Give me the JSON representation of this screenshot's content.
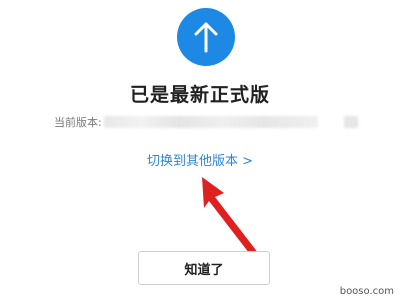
{
  "header": {
    "status_icon": "upload-arrow-icon",
    "title": "已是最新正式版"
  },
  "version": {
    "label": "当前版本:"
  },
  "link": {
    "switch_label": "切换到其他版本 >"
  },
  "footer": {
    "ok_label": "知道了"
  },
  "watermark": {
    "text": "booso.com"
  },
  "colors": {
    "accent": "#1e88e5",
    "link": "#2f86d6",
    "annotation_arrow": "#e02020"
  }
}
